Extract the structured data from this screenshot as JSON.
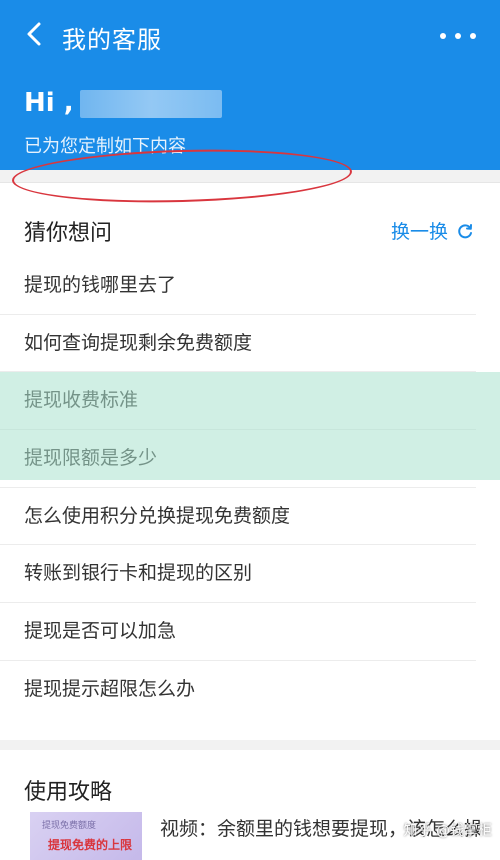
{
  "header": {
    "title": "我的客服",
    "greeting": "Hi ,",
    "subtitle": "已为您定制如下内容"
  },
  "faq": {
    "section_title": "猜你想问",
    "refresh_label": "换一换",
    "items": [
      "提现的钱哪里去了",
      "如何查询提现剩余免费额度",
      "提现收费标准",
      "提现限额是多少",
      "怎么使用积分兑换提现免费额度",
      "转账到银行卡和提现的区别",
      "提现是否可以加急",
      "提现提示超限怎么办"
    ]
  },
  "guide": {
    "section_title": "使用攻略",
    "video_title": "视频：余额里的钱想要提现，该怎么操作？",
    "thumb_top": "提现免费额度",
    "thumb_text": "提现免费的上限"
  },
  "watermark": "知乎 @钱掌柜",
  "colors": {
    "brand_blue": "#1a8ce8",
    "highlight_red": "#d9363e"
  }
}
